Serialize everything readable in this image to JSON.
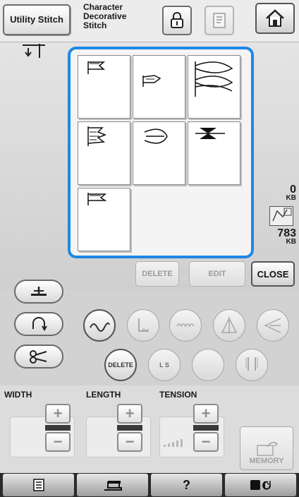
{
  "topbar": {
    "mode_button": "Utility Stitch",
    "mode_title_lines": [
      "Character",
      "Decorative",
      "Stitch"
    ]
  },
  "pattern_list": {
    "patterns": [
      {
        "name": "flag-stitch-1"
      },
      {
        "name": "flag-stitch-2"
      },
      {
        "name": "wave-leaf-stitch"
      },
      {
        "name": "feather-flag-stitch"
      },
      {
        "name": "loop-stitch"
      },
      {
        "name": "bowtie-stitch"
      },
      {
        "name": "flag-stitch-3"
      }
    ]
  },
  "memory": {
    "used_value": "0",
    "used_unit": "KB",
    "free_value": "783",
    "free_unit": "KB"
  },
  "actions": {
    "delete": "DELETE",
    "edit": "EDIT",
    "close": "CLOSE"
  },
  "function_buttons": {
    "delete": "DELETE",
    "ls": "L  S"
  },
  "settings": {
    "width_label": "WIDTH",
    "length_label": "LENGTH",
    "tension_label": "TENSION",
    "plus": "+",
    "minus": "−",
    "memory_label": "MEMORY"
  },
  "bottombar": {
    "help": "?"
  },
  "colors": {
    "selection_border": "#1e88e5"
  }
}
